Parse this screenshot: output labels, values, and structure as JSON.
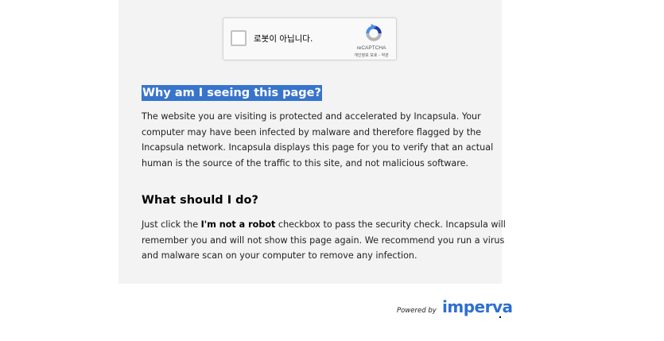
{
  "recaptcha": {
    "checkbox_label": "로봇이 아닙니다.",
    "brand": "reCAPTCHA",
    "privacy_link": "개인정보 보호",
    "separator": " - ",
    "terms_link": "약관"
  },
  "section1": {
    "heading": "Why am I seeing this page?",
    "lines": [
      "The website you are visiting is protected and accelerated by Incapsula. Your",
      "computer may have been infected by malware and therefore flagged by the",
      "Incapsula network. Incapsula displays this page for you to verify that an actual",
      "human is the source of the traffic to this site, and not malicious software."
    ]
  },
  "section2": {
    "heading": "What should I do?",
    "line1_before": "Just click the ",
    "line1_bold": "I'm not a robot",
    "line1_after": " checkbox to pass the security check. Incapsula will",
    "line2": "remember you and will not show this page again. We recommend you run a virus",
    "line3": "and malware scan on your computer to remove any infection."
  },
  "footer": {
    "powered_by": "Powered by",
    "brand": "imperva"
  },
  "colors": {
    "panel_bg": "#f3f3f3",
    "heading_highlight": "#3874cb",
    "imperva_blue": "#2e6fd0"
  }
}
